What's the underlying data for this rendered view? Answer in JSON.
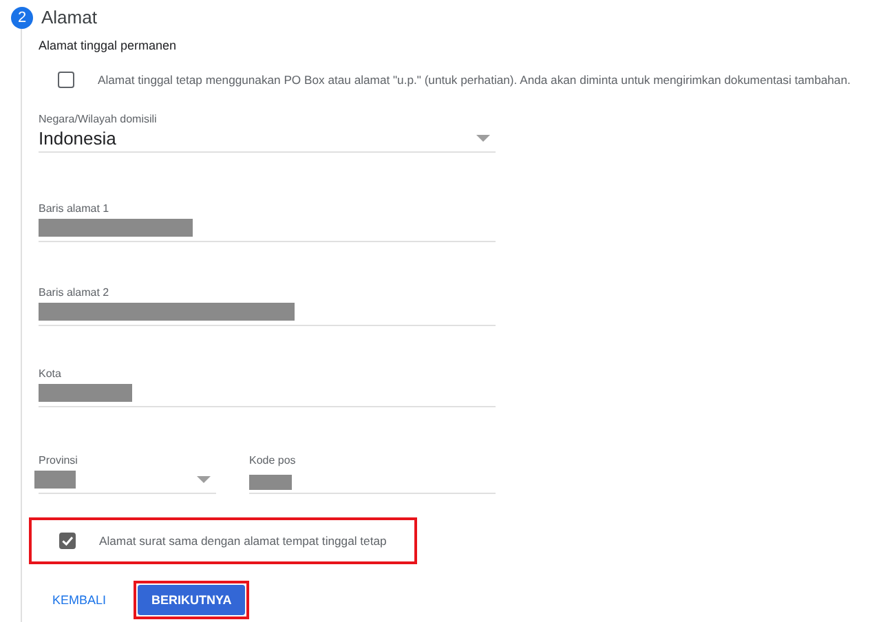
{
  "step": {
    "number": "2",
    "title": "Alamat"
  },
  "section_title": "Alamat tinggal permanen",
  "po_box_option": {
    "label": "Alamat tinggal tetap menggunakan PO Box atau alamat \"u.p.\" (untuk perhatian). Anda akan diminta untuk mengirimkan dokumentasi tambahan.",
    "checked": false
  },
  "fields": [
    {
      "kind": "select",
      "label": "Negara/Wilayah domisili",
      "value": "Indonesia"
    },
    {
      "kind": "text",
      "label": "Baris alamat 1",
      "redacted": true
    },
    {
      "kind": "text",
      "label": "Baris alamat 2",
      "redacted": true
    },
    {
      "kind": "text",
      "label": "Kota",
      "redacted": true
    }
  ],
  "row_fields": [
    {
      "kind": "select",
      "label": "Provinsi",
      "redacted": true
    },
    {
      "kind": "text",
      "label": "Kode pos",
      "redacted": true
    }
  ],
  "mailing_option": {
    "label": "Alamat surat sama dengan alamat tempat tinggal tetap",
    "checked": true,
    "highlighted": true
  },
  "buttons": [
    {
      "kind": "text",
      "label": "KEMBALI",
      "highlighted": false
    },
    {
      "kind": "primary",
      "label": "BERIKUTNYA",
      "highlighted": true
    }
  ]
}
